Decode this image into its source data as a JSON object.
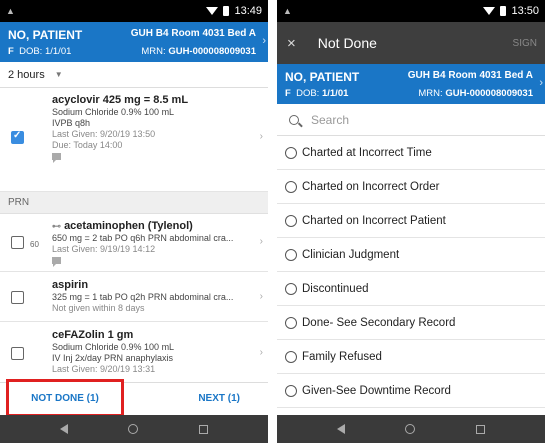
{
  "left": {
    "status": {
      "time": "13:49"
    },
    "patient": {
      "name": "NO, PATIENT",
      "room": "GUH B4 Room 4031 Bed A",
      "sex": "F",
      "dob_label": "DOB:",
      "dob": "1/1/01",
      "mrn_label": "MRN:",
      "mrn": "GUH-000008009031"
    },
    "time_filter": "2 hours",
    "scheduled_meds": [
      {
        "name": "acyclovir 425 mg = 8.5 mL",
        "lines": [
          "Sodium Chloride 0.9% 100 mL",
          "IVPB q8h"
        ],
        "muted_lines": [
          "Last Given: 9/20/19 13:50",
          "Due: Today 14:00"
        ],
        "checked": true
      }
    ],
    "prn_header": "PRN",
    "prn_meds": [
      {
        "name": "acetaminophen (Tylenol)",
        "prefix": "60",
        "lines": [
          "650 mg = 2 tab PO q6h PRN abdominal cra..."
        ],
        "muted_lines": [
          "Last Given: 9/19/19 14:12"
        ]
      },
      {
        "name": "aspirin",
        "lines": [
          "325 mg = 1 tab PO q2h PRN abdominal cra..."
        ],
        "muted_lines": [
          "Not given within 8 days"
        ]
      },
      {
        "name": "ceFAZolin 1 gm",
        "lines": [
          "Sodium Chloride 0.9% 100 mL",
          "IV Inj 2x/day PRN anaphylaxis"
        ],
        "muted_lines": [
          "Last Given: 9/20/19 13:31"
        ]
      }
    ],
    "buttons": {
      "not_done": "NOT DONE (1)",
      "next": "NEXT (1)"
    }
  },
  "right": {
    "status": {
      "time": "13:50"
    },
    "app_bar": {
      "close": "×",
      "title": "Not Done",
      "sign": "SIGN"
    },
    "patient": {
      "name": "NO, PATIENT",
      "room": "GUH B4 Room 4031 Bed A",
      "sex": "F",
      "dob_label": "DOB:",
      "dob": "1/1/01",
      "mrn_label": "MRN:",
      "mrn": "GUH-000008009031"
    },
    "search": {
      "placeholder": "Search"
    },
    "reasons": [
      "Charted at Incorrect Time",
      "Charted on Incorrect Order",
      "Charted on Incorrect Patient",
      "Clinician Judgment",
      "Discontinued",
      "Done- See Secondary Record",
      "Family Refused",
      "Given-See Downtime Record"
    ]
  },
  "colors": {
    "brand_blue": "#1a76c6",
    "highlight_red": "#e02020",
    "app_bar_dark": "#3e3e3e"
  },
  "icons": [
    "wifi-icon",
    "battery-icon",
    "close-icon",
    "search-icon",
    "checkbox-icon",
    "radio-icon",
    "note-icon",
    "pill-icon",
    "back-icon",
    "home-icon",
    "recents-icon"
  ]
}
